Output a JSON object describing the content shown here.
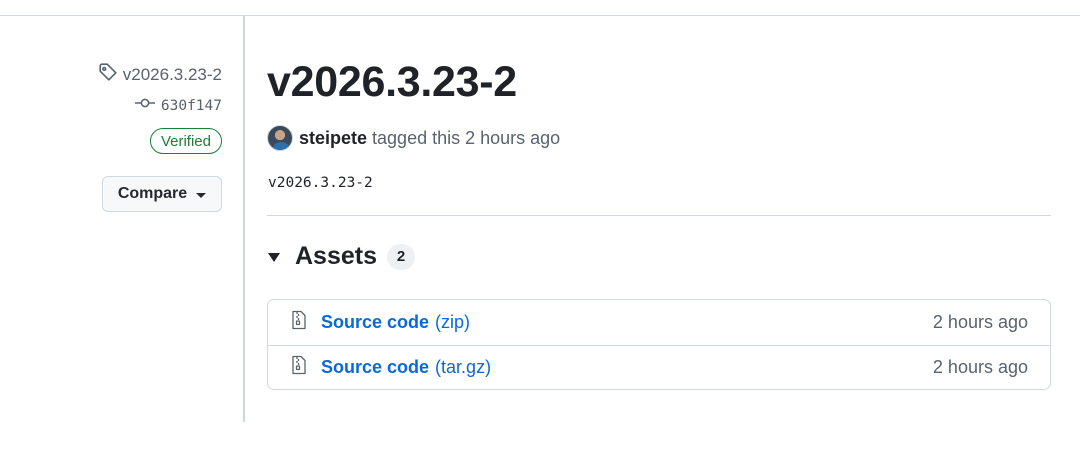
{
  "sidebar": {
    "tag_name": "v2026.3.23-2",
    "commit_sha": "630f147",
    "verified_label": "Verified",
    "compare_label": "Compare"
  },
  "release": {
    "title": "v2026.3.23-2",
    "author": "steipete",
    "tagged_text": "tagged this 2 hours ago",
    "body": "v2026.3.23-2"
  },
  "assets": {
    "title": "Assets",
    "count": "2",
    "items": [
      {
        "name": "Source code",
        "ext": "(zip)",
        "time": "2 hours ago",
        "icon": "file-zip-icon"
      },
      {
        "name": "Source code",
        "ext": "(tar.gz)",
        "time": "2 hours ago",
        "icon": "file-zip-icon"
      }
    ]
  },
  "colors": {
    "link": "#0969da",
    "verified": "#1a7f37",
    "muted": "#59636e",
    "border": "#d1d9e0"
  }
}
